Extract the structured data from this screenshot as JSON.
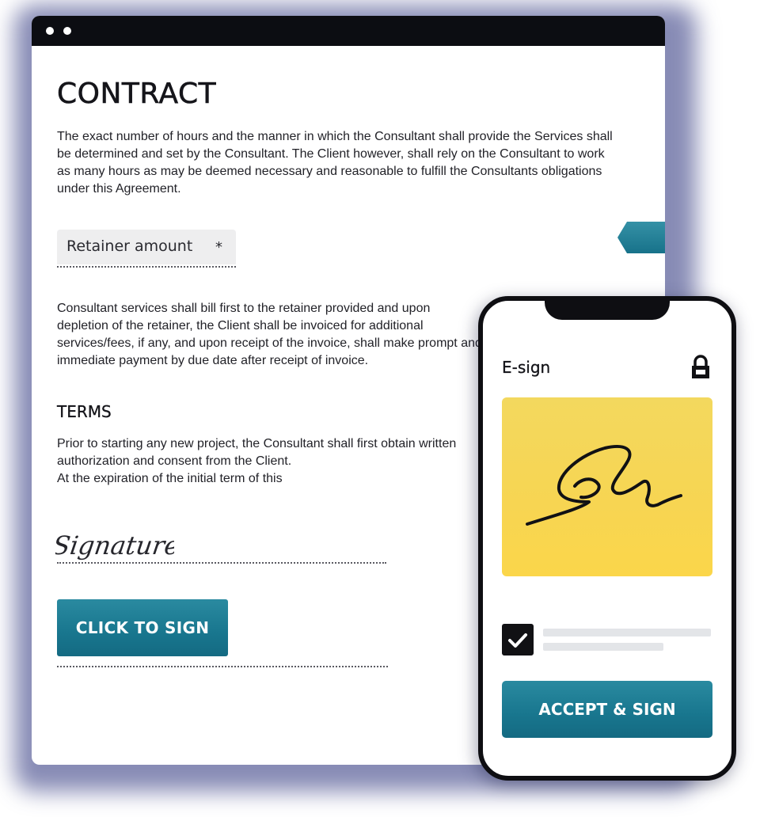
{
  "contract": {
    "title": "CONTRACT",
    "intro": "The exact number of hours and the manner in which the Consultant shall provide the Services shall be determined and set by the Consultant. The Client however, shall rely on the Consultant to work as many hours as may be deemed necessary and reasonable to fulfill the Consultants obligations under this Agreement.",
    "retainer_label": "Retainer amount",
    "required_marker": "*",
    "billing_text": "Consultant services shall bill first to the retainer provided and upon depletion of the retainer, the Client shall be invoiced for additional services/fees, if any, and upon receipt of the invoice, shall make prompt and immediate payment by due date after receipt of invoice.",
    "terms_heading": "TERMS",
    "terms_line_1": "Prior to starting any new project, the Consultant shall first obtain written",
    "terms_line_2": "authorization and consent from the Client.",
    "terms_line_3": "At the expiration of the initial term of this",
    "signature_word": "Signature",
    "sign_button": "CLICK TO SIGN"
  },
  "phone": {
    "title": "E-sign",
    "lock_icon": "lock-icon",
    "checkbox_checked": true,
    "accept_button": "ACCEPT & SIGN"
  },
  "colors": {
    "accent_teal": "#18768e",
    "signature_pad_yellow": "#f7d552",
    "window_chrome": "#0c0d12",
    "background_glow": "#242c78"
  }
}
